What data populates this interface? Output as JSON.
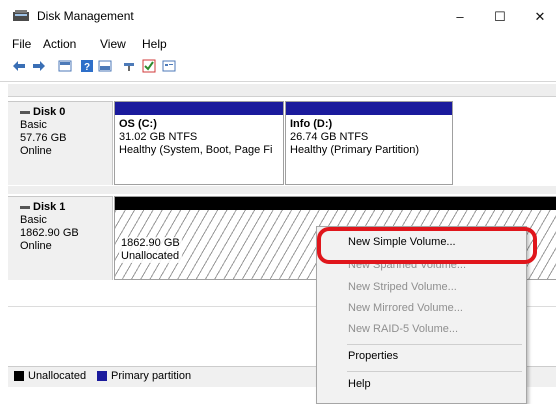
{
  "window": {
    "title": "Disk Management",
    "minimize": "–",
    "maximize": "☐",
    "close": "✕"
  },
  "menu": [
    "File",
    "Action",
    "View",
    "Help"
  ],
  "toolbar_icons": [
    "back-arrow-icon",
    "forward-arrow-icon",
    "disk-list-icon",
    "help-icon",
    "volume-list-icon",
    "connect-icon",
    "check-icon",
    "properties-icon"
  ],
  "disks": [
    {
      "name": "Disk 0",
      "type": "Basic",
      "size": "57.76 GB",
      "status": "Online",
      "volumes": [
        {
          "name": "OS  (C:)",
          "size": "31.02 GB NTFS",
          "status": "Healthy (System, Boot, Page Fi"
        },
        {
          "name": "Info  (D:)",
          "size": "26.74 GB NTFS",
          "status": "Healthy (Primary Partition)"
        }
      ]
    },
    {
      "name": "Disk 1",
      "type": "Basic",
      "size": "1862.90 GB",
      "status": "Online",
      "volumes": [
        {
          "size": "1862.90 GB",
          "status": "Unallocated"
        }
      ]
    }
  ],
  "legend": {
    "unallocated": "Unallocated",
    "primary": "Primary partition",
    "unallocated_color": "#000000",
    "primary_color": "#1a1a9c"
  },
  "context_menu": {
    "items": [
      {
        "label": "New Simple Volume...",
        "enabled": true
      },
      {
        "label": "New Spanned Volume...",
        "enabled": false
      },
      {
        "label": "New Striped Volume...",
        "enabled": false
      },
      {
        "label": "New Mirrored Volume...",
        "enabled": false
      },
      {
        "label": "New RAID-5 Volume...",
        "enabled": false
      },
      {
        "label": "Properties",
        "enabled": true
      },
      {
        "label": "Help",
        "enabled": true
      }
    ]
  },
  "colors": {
    "primary_partition": "#1a1a9c",
    "unallocated": "#000000",
    "highlight": "#e0161c"
  }
}
